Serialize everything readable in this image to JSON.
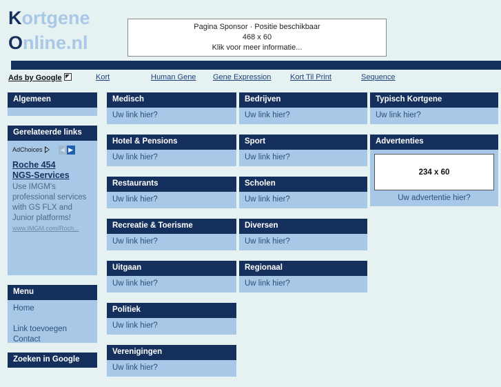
{
  "site": {
    "logo_line1_cap": "K",
    "logo_line1_rest": "ortgene",
    "logo_line2_cap": "O",
    "logo_line2_rest": "nline.nl"
  },
  "sponsor": {
    "line1": "Pagina Sponsor · Positie beschikbaar",
    "line2": "468 x 60",
    "line3": "Klik voor meer informatie..."
  },
  "nav": {
    "ads_label": "Ads by Google",
    "links": [
      {
        "label": "Kort"
      },
      {
        "label": "Human Gene"
      },
      {
        "label": "Gene Expression"
      },
      {
        "label": "Kort Til Print"
      },
      {
        "label": "Sequence"
      }
    ]
  },
  "sidebar": {
    "algemeen": {
      "title": "Algemeen"
    },
    "gerelateerde": {
      "title": "Gerelateerde links",
      "adchoices_label": "AdChoices",
      "prev_arrow": "◀",
      "next_arrow": "▶",
      "ad_title_line1": "Roche 454",
      "ad_title_line2": "NGS-Services",
      "ad_desc": "Use IMGM's professional services with GS FLX and Junior platforms!",
      "ad_url": "www.IMGM.com/Roch..."
    },
    "menu": {
      "title": "Menu",
      "items": [
        {
          "label": "Home"
        },
        {
          "label": "Link toevoegen"
        },
        {
          "label": "Contact"
        }
      ]
    },
    "zoeken": {
      "title": "Zoeken in Google"
    }
  },
  "link_placeholder": "Uw link hier?",
  "columns": {
    "col1": [
      {
        "title": "Medisch",
        "link": "Uw link hier?"
      },
      {
        "title": "Hotel & Pensions",
        "link": "Uw link hier?"
      },
      {
        "title": "Restaurants",
        "link": "Uw link hier?"
      },
      {
        "title": "Recreatie & Toerisme",
        "link": "Uw link hier?"
      },
      {
        "title": "Uitgaan",
        "link": "Uw link hier?"
      },
      {
        "title": "Politiek",
        "link": "Uw link hier?"
      },
      {
        "title": "Verenigingen",
        "link": "Uw link hier?"
      }
    ],
    "col2": [
      {
        "title": "Bedrijven",
        "link": "Uw link hier?"
      },
      {
        "title": "Sport",
        "link": "Uw link hier?"
      },
      {
        "title": "Scholen",
        "link": "Uw link hier?"
      },
      {
        "title": "Diversen",
        "link": "Uw link hier?"
      },
      {
        "title": "Regionaal",
        "link": "Uw link hier?"
      }
    ],
    "col3": [
      {
        "title": "Typisch Kortgene",
        "link": "Uw link hier?"
      }
    ]
  },
  "advertenties": {
    "title": "Advertenties",
    "slot_size": "234 x 60",
    "caption": "Uw advertentie hier?"
  },
  "colors": {
    "page_bg": "#e6f1f1",
    "navy": "#16305e",
    "panel_blue": "#a8c8e8",
    "link_text": "#2f5178"
  }
}
